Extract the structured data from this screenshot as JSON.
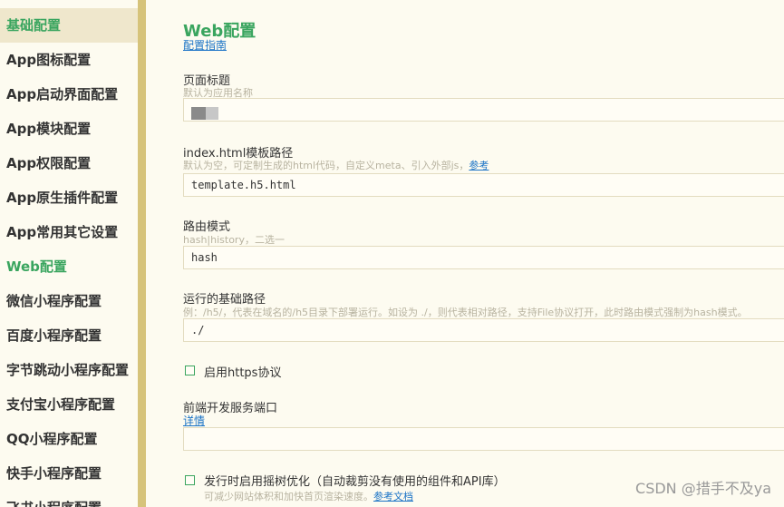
{
  "sidebar": {
    "items": [
      {
        "label": "基础配置"
      },
      {
        "label": "App图标配置"
      },
      {
        "label": "App启动界面配置"
      },
      {
        "label": "App模块配置"
      },
      {
        "label": "App权限配置"
      },
      {
        "label": "App原生插件配置"
      },
      {
        "label": "App常用其它设置"
      },
      {
        "label": "Web配置"
      },
      {
        "label": "微信小程序配置"
      },
      {
        "label": "百度小程序配置"
      },
      {
        "label": "字节跳动小程序配置"
      },
      {
        "label": "支付宝小程序配置"
      },
      {
        "label": "QQ小程序配置"
      },
      {
        "label": "快手小程序配置"
      },
      {
        "label": "飞书小程序配置"
      }
    ]
  },
  "main": {
    "title": "Web配置",
    "guide_link": "配置指南",
    "page_title": {
      "label": "页面标题",
      "hint": "默认为应用名称",
      "value": ""
    },
    "template_path": {
      "label": "index.html模板路径",
      "hint": "默认为空，可定制生成的html代码，自定义meta、引入外部js，",
      "hint_link": "参考",
      "value": "template.h5.html"
    },
    "router_mode": {
      "label": "路由模式",
      "hint": "hash|history，二选一",
      "value": "hash"
    },
    "base_path": {
      "label": "运行的基础路径",
      "hint": "例：/h5/，代表在域名的/h5目录下部署运行。如设为 ./，则代表相对路径，支持File协议打开，此时路由模式强制为hash模式。",
      "value": "./"
    },
    "https": {
      "label": "启用https协议"
    },
    "dev_port": {
      "label": "前端开发服务端口",
      "link": "详情",
      "value": ""
    },
    "tree_shaking": {
      "label": "发行时启用摇树优化（自动裁剪没有使用的组件和API库）",
      "hint": "可减少网站体积和加快首页渲染速度。",
      "hint_link": "参考文档"
    }
  },
  "watermark": "CSDN @措手不及ya",
  "colors": {
    "accent": "#3aa55f",
    "link": "#1a73c6",
    "sidebar_border": "#d6c37a",
    "background": "#fdfbf0"
  }
}
